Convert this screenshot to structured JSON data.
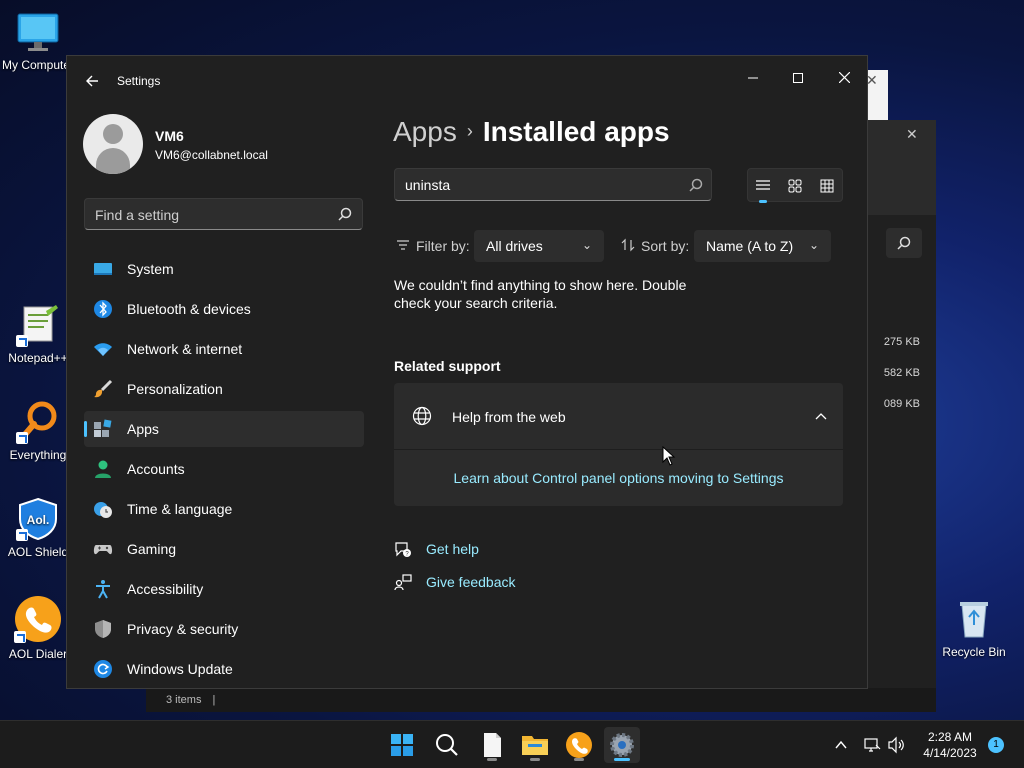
{
  "desktop": {
    "icons": [
      {
        "label": "My Computer",
        "icon": "monitor-icon"
      },
      {
        "label": "Notepad++",
        "icon": "notepad-plus-plus-icon"
      },
      {
        "label": "Everything",
        "icon": "everything-search-icon"
      },
      {
        "label": "AOL Shield",
        "icon": "aol-shield-icon"
      },
      {
        "label": "AOL Dialer",
        "icon": "aol-dialer-icon"
      },
      {
        "label": "Recycle Bin",
        "icon": "recycle-bin-icon"
      }
    ]
  },
  "background_window": {
    "sizes": [
      "275 KB",
      "582 KB",
      "089 KB"
    ],
    "status": "3 items"
  },
  "settings": {
    "title": "Settings",
    "user": {
      "name": "VM6",
      "email": "VM6@collabnet.local"
    },
    "find_placeholder": "Find a setting",
    "nav": [
      {
        "label": "System",
        "icon": "system-display-icon"
      },
      {
        "label": "Bluetooth & devices",
        "icon": "bluetooth-icon"
      },
      {
        "label": "Network & internet",
        "icon": "wifi-icon"
      },
      {
        "label": "Personalization",
        "icon": "brush-icon"
      },
      {
        "label": "Apps",
        "icon": "apps-icon",
        "active": true
      },
      {
        "label": "Accounts",
        "icon": "person-icon"
      },
      {
        "label": "Time & language",
        "icon": "globe-clock-icon"
      },
      {
        "label": "Gaming",
        "icon": "gamepad-icon"
      },
      {
        "label": "Accessibility",
        "icon": "accessibility-icon"
      },
      {
        "label": "Privacy & security",
        "icon": "shield-icon"
      },
      {
        "label": "Windows Update",
        "icon": "update-icon"
      }
    ],
    "breadcrumb": {
      "parent": "Apps",
      "separator": "›",
      "current": "Installed apps"
    },
    "search_value": "uninsta",
    "filter": {
      "label": "Filter by:",
      "value": "All drives"
    },
    "sort": {
      "label": "Sort by:",
      "value": "Name (A to Z)"
    },
    "empty_message": "We couldn’t find anything to show here. Double check your search criteria.",
    "related_support": {
      "heading": "Related support",
      "panel_title": "Help from the web",
      "panel_link": "Learn about Control panel options moving to Settings"
    },
    "get_help": "Get help",
    "give_feedback": "Give feedback"
  },
  "taskbar": {
    "apps": [
      "start-icon",
      "search-icon",
      "notepad-icon",
      "file-explorer-icon",
      "aol-dialer-icon",
      "settings-gear-icon"
    ],
    "time": "2:28 AM",
    "date": "4/14/2023",
    "notifications": "1"
  },
  "colors": {
    "accent": "#4cc2ff",
    "link": "#99ebff",
    "window_bg": "#202020"
  }
}
